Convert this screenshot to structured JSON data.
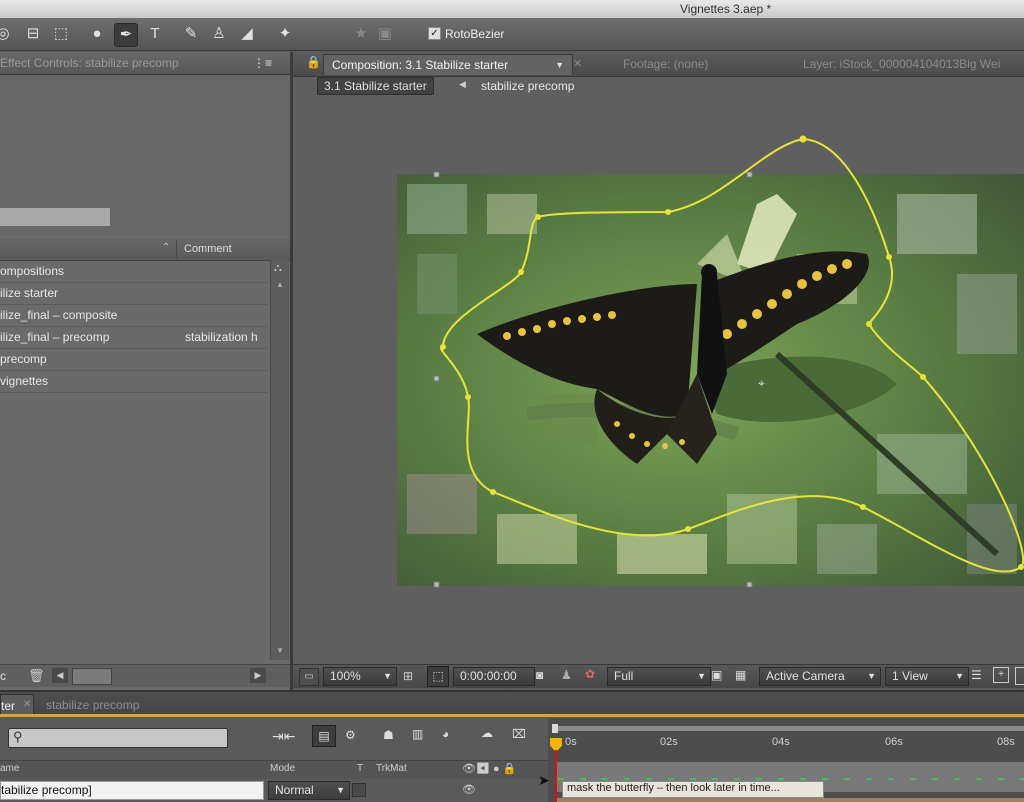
{
  "window": {
    "title": "Vignettes 3.aep *"
  },
  "toolbar": {
    "rotobezier_label": "RotoBezier",
    "rotobezier_checked": true
  },
  "effect_controls": {
    "tab_label": "Effect Controls: stabilize precomp"
  },
  "project": {
    "comment_header": "Comment",
    "rows": [
      {
        "name": "ompositions",
        "comment": ""
      },
      {
        "name": "ilize starter",
        "comment": ""
      },
      {
        "name": "ilize_final – composite",
        "comment": ""
      },
      {
        "name": "ilize_final – precomp",
        "comment": "stabilization h"
      },
      {
        "name": "precomp",
        "comment": ""
      },
      {
        "name": "vignettes",
        "comment": ""
      }
    ],
    "bpc_label": "c"
  },
  "viewer": {
    "tabs": {
      "composition": "Composition: 3.1 Stabilize starter",
      "footage": "Footage: (none)",
      "layer": "Layer: iStock_000004104013Big Wei"
    },
    "breadcrumb": {
      "active": "3.1 Stabilize starter",
      "child": "stabilize precomp"
    },
    "bottom_bar": {
      "zoom": "100%",
      "timecode": "0:00:00:00",
      "resolution": "Full",
      "camera": "Active Camera",
      "views": "1 View"
    }
  },
  "timeline": {
    "tabs": {
      "active": "ter",
      "other": "stabilize precomp"
    },
    "columns": {
      "name": "ame",
      "mode": "Mode",
      "t": "T",
      "trkmat": "TrkMat"
    },
    "layer": {
      "name": "tabilize precomp]",
      "mode": "Normal"
    },
    "ruler": [
      "0s",
      "02s",
      "04s",
      "06s",
      "08s"
    ],
    "marker_comment": "mask the butterfly – then look later in time..."
  },
  "colors": {
    "mask": "#e7e33a",
    "playhead": "#f2b400",
    "work_area": "#d6a14a"
  }
}
